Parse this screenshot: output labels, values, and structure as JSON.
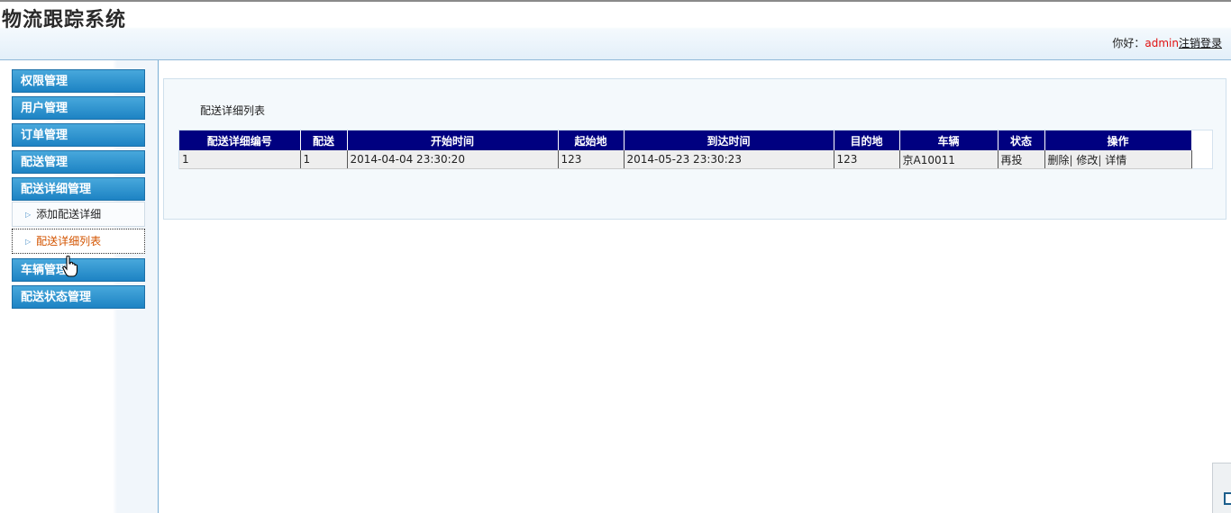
{
  "header": {
    "title": "物流跟踪系统",
    "greeting": "你好：",
    "username": "admin",
    "logout": "注销登录"
  },
  "sidebar": {
    "menus": [
      {
        "label": "权限管理"
      },
      {
        "label": "用户管理"
      },
      {
        "label": "订单管理"
      },
      {
        "label": "配送管理"
      },
      {
        "label": "配送详细管理"
      },
      {
        "label": "车辆管理"
      },
      {
        "label": "配送状态管理"
      }
    ],
    "submenu": [
      {
        "label": "添加配送详细"
      },
      {
        "label": "配送详细列表",
        "active": true
      }
    ],
    "arrow_glyph": "▷"
  },
  "main": {
    "panel_title": "配送详细列表",
    "table": {
      "columns": [
        "配送详细编号",
        "配送",
        "开始时间",
        "起始地",
        "到达时间",
        "目的地",
        "车辆",
        "状态",
        "操作"
      ],
      "rows": [
        {
          "id": "1",
          "delivery": "1",
          "start_time": "2014-04-04 23:30:20",
          "origin": "123",
          "arrive_time": "2014-05-23 23:30:23",
          "destination": "123",
          "vehicle": "京A10011",
          "status": "再投",
          "ops": {
            "delete": "删除",
            "edit": "修改",
            "detail": "详情",
            "sep": "|"
          }
        }
      ]
    }
  },
  "colors": {
    "menu_header": "#1d83c4",
    "table_header": "#000080",
    "username": "#e01010",
    "active_submenu": "#d35400"
  }
}
